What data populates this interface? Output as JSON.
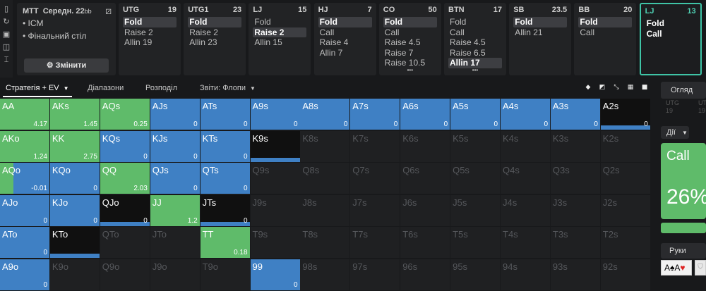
{
  "colors": {
    "green": "#5fbb6a",
    "blue": "#3f80c4",
    "dark_cell": "#1f2022",
    "black_cell": "#101010",
    "accent": "#3fc4a6"
  },
  "rail_icons": [
    "bookmark-icon",
    "refresh-icon",
    "save-icon",
    "gamepad-icon",
    "text-icon"
  ],
  "header": {
    "title": "MTT",
    "stack_label": "Середн. 22",
    "stack_unit": "bb",
    "options": [
      "ICM",
      "Фінальний стіл"
    ],
    "change_button": "Змінити"
  },
  "positions": [
    {
      "name": "UTG",
      "stack": "19",
      "actions": [
        "Fold",
        "Raise 2",
        "Allin 19"
      ],
      "selected": 0,
      "more": false,
      "active": false
    },
    {
      "name": "UTG1",
      "stack": "23",
      "actions": [
        "Fold",
        "Raise 2",
        "Allin 23"
      ],
      "selected": 0,
      "more": false,
      "active": false
    },
    {
      "name": "LJ",
      "stack": "15",
      "actions": [
        "Fold",
        "Raise 2",
        "Allin 15"
      ],
      "selected": 1,
      "more": false,
      "active": false
    },
    {
      "name": "HJ",
      "stack": "7",
      "actions": [
        "Fold",
        "Call",
        "Raise 4",
        "Allin 7"
      ],
      "selected": 0,
      "more": false,
      "active": false
    },
    {
      "name": "CO",
      "stack": "50",
      "actions": [
        "Fold",
        "Call",
        "Raise 4.5",
        "Raise 7",
        "Raise 10.5"
      ],
      "selected": 0,
      "more": true,
      "active": false
    },
    {
      "name": "BTN",
      "stack": "17",
      "actions": [
        "Fold",
        "Call",
        "Raise 4.5",
        "Raise 6.5",
        "Allin 17"
      ],
      "selected": 4,
      "more": true,
      "active": false
    },
    {
      "name": "SB",
      "stack": "23.5",
      "actions": [
        "Fold",
        "Allin 21"
      ],
      "selected": 0,
      "more": false,
      "active": false
    },
    {
      "name": "BB",
      "stack": "20",
      "actions": [
        "Fold",
        "Call"
      ],
      "selected": 0,
      "more": false,
      "active": false
    },
    {
      "name": "LJ",
      "stack": "13",
      "actions": [
        "Fold",
        "Call"
      ],
      "selected": -1,
      "more": false,
      "active": true
    }
  ],
  "tabs": [
    {
      "label": "Стратегія + EV",
      "dropdown": true,
      "selected": true
    },
    {
      "label": "Діапазони",
      "dropdown": false,
      "selected": false
    },
    {
      "label": "Розподіл",
      "dropdown": false,
      "selected": false
    },
    {
      "label": "Звіти: Флопи",
      "dropdown": true,
      "selected": false
    }
  ],
  "view_tools": [
    "cube-icon",
    "contrast-icon",
    "compress-icon",
    "grid-icon",
    "square-icon"
  ],
  "grid": [
    [
      {
        "h": "AA",
        "g": 1,
        "b": 0,
        "ev": "4.17"
      },
      {
        "h": "AKs",
        "g": 1,
        "b": 0,
        "ev": "1.45"
      },
      {
        "h": "AQs",
        "g": 1,
        "b": 0,
        "ev": "0.25"
      },
      {
        "h": "AJs",
        "g": 0,
        "b": 1,
        "ev": "0"
      },
      {
        "h": "ATs",
        "g": 0,
        "b": 1,
        "ev": "0"
      },
      {
        "h": "A9s",
        "g": 0,
        "b": 1,
        "ev": "0"
      },
      {
        "h": "A8s",
        "g": 0,
        "b": 1,
        "ev": "0"
      },
      {
        "h": "A7s",
        "g": 0,
        "b": 1,
        "ev": "0"
      },
      {
        "h": "A6s",
        "g": 0,
        "b": 1,
        "ev": "0"
      },
      {
        "h": "A5s",
        "g": 0,
        "b": 1,
        "ev": "0"
      },
      {
        "h": "A4s",
        "g": 0,
        "b": 1,
        "ev": "0"
      },
      {
        "h": "A3s",
        "g": 0,
        "b": 1,
        "ev": "0"
      },
      {
        "h": "A2s",
        "g": 0,
        "b": 0,
        "ev": "0",
        "bar": 1,
        "black": true
      }
    ],
    [
      {
        "h": "AKo",
        "g": 1,
        "b": 0,
        "ev": "1.24"
      },
      {
        "h": "KK",
        "g": 1,
        "b": 0,
        "ev": "2.75"
      },
      {
        "h": "KQs",
        "g": 0,
        "b": 1,
        "ev": "0"
      },
      {
        "h": "KJs",
        "g": 0,
        "b": 1,
        "ev": "0"
      },
      {
        "h": "KTs",
        "g": 0,
        "b": 1,
        "ev": "0"
      },
      {
        "h": "K9s",
        "g": 0,
        "b": 0,
        "ev": "",
        "bar": 1,
        "black": true
      },
      {
        "h": "K8s",
        "dim": true
      },
      {
        "h": "K7s",
        "dim": true
      },
      {
        "h": "K6s",
        "dim": true
      },
      {
        "h": "K5s",
        "dim": true
      },
      {
        "h": "K4s",
        "dim": true
      },
      {
        "h": "K3s",
        "dim": true
      },
      {
        "h": "K2s",
        "dim": true
      }
    ],
    [
      {
        "h": "AQo",
        "g": 0.27,
        "b": 0.73,
        "ev": "-0.01"
      },
      {
        "h": "KQo",
        "g": 0,
        "b": 1,
        "ev": "0"
      },
      {
        "h": "QQ",
        "g": 1,
        "b": 0,
        "ev": "2.03"
      },
      {
        "h": "QJs",
        "g": 0,
        "b": 1,
        "ev": "0"
      },
      {
        "h": "QTs",
        "g": 0,
        "b": 1,
        "ev": "0"
      },
      {
        "h": "Q9s",
        "dim": true
      },
      {
        "h": "Q8s",
        "dim": true
      },
      {
        "h": "Q7s",
        "dim": true
      },
      {
        "h": "Q6s",
        "dim": true
      },
      {
        "h": "Q5s",
        "dim": true
      },
      {
        "h": "Q4s",
        "dim": true
      },
      {
        "h": "Q3s",
        "dim": true
      },
      {
        "h": "Q2s",
        "dim": true
      }
    ],
    [
      {
        "h": "AJo",
        "g": 0,
        "b": 1,
        "ev": "0"
      },
      {
        "h": "KJo",
        "g": 0,
        "b": 1,
        "ev": "0"
      },
      {
        "h": "QJo",
        "g": 0,
        "b": 0,
        "ev": "0",
        "bar": 1,
        "black": true
      },
      {
        "h": "JJ",
        "g": 1,
        "b": 0,
        "ev": "1.2"
      },
      {
        "h": "JTs",
        "g": 0,
        "b": 0,
        "ev": "0",
        "bar": 1,
        "black": true
      },
      {
        "h": "J9s",
        "dim": true
      },
      {
        "h": "J8s",
        "dim": true
      },
      {
        "h": "J7s",
        "dim": true
      },
      {
        "h": "J6s",
        "dim": true
      },
      {
        "h": "J5s",
        "dim": true
      },
      {
        "h": "J4s",
        "dim": true
      },
      {
        "h": "J3s",
        "dim": true
      },
      {
        "h": "J2s",
        "dim": true
      }
    ],
    [
      {
        "h": "ATo",
        "g": 0,
        "b": 1,
        "ev": "0"
      },
      {
        "h": "KTo",
        "g": 0,
        "b": 0,
        "ev": "",
        "bar": 1,
        "black": true
      },
      {
        "h": "QTo",
        "dim": true
      },
      {
        "h": "JTo",
        "dim": true
      },
      {
        "h": "TT",
        "g": 1,
        "b": 0,
        "ev": "0.18"
      },
      {
        "h": "T9s",
        "dim": true
      },
      {
        "h": "T8s",
        "dim": true
      },
      {
        "h": "T7s",
        "dim": true
      },
      {
        "h": "T6s",
        "dim": true
      },
      {
        "h": "T5s",
        "dim": true
      },
      {
        "h": "T4s",
        "dim": true
      },
      {
        "h": "T3s",
        "dim": true
      },
      {
        "h": "T2s",
        "dim": true
      }
    ],
    [
      {
        "h": "A9o",
        "g": 0,
        "b": 1,
        "ev": "0"
      },
      {
        "h": "K9o",
        "dim": true
      },
      {
        "h": "Q9o",
        "dim": true
      },
      {
        "h": "J9o",
        "dim": true
      },
      {
        "h": "T9o",
        "dim": true
      },
      {
        "h": "99",
        "g": 0,
        "b": 1,
        "ev": "0"
      },
      {
        "h": "98s",
        "dim": true
      },
      {
        "h": "97s",
        "dim": true
      },
      {
        "h": "96s",
        "dim": true
      },
      {
        "h": "95s",
        "dim": true
      },
      {
        "h": "94s",
        "dim": true
      },
      {
        "h": "93s",
        "dim": true
      },
      {
        "h": "92s",
        "dim": true
      }
    ]
  ],
  "right_panel": {
    "overview_tab": "Огляд",
    "ghost_positions": [
      {
        "name": "UTG",
        "stack": "19"
      },
      {
        "name": "UTG",
        "stack": "19"
      }
    ],
    "actions_label": "Дії",
    "action": "Call",
    "percent": "26%",
    "hands_label": "Руки",
    "card_text_rank1": "A",
    "card_suit1": "♠",
    "card_text_rank2": "A",
    "card_suit2": "♥",
    "shield_icon": "shield-icon"
  }
}
